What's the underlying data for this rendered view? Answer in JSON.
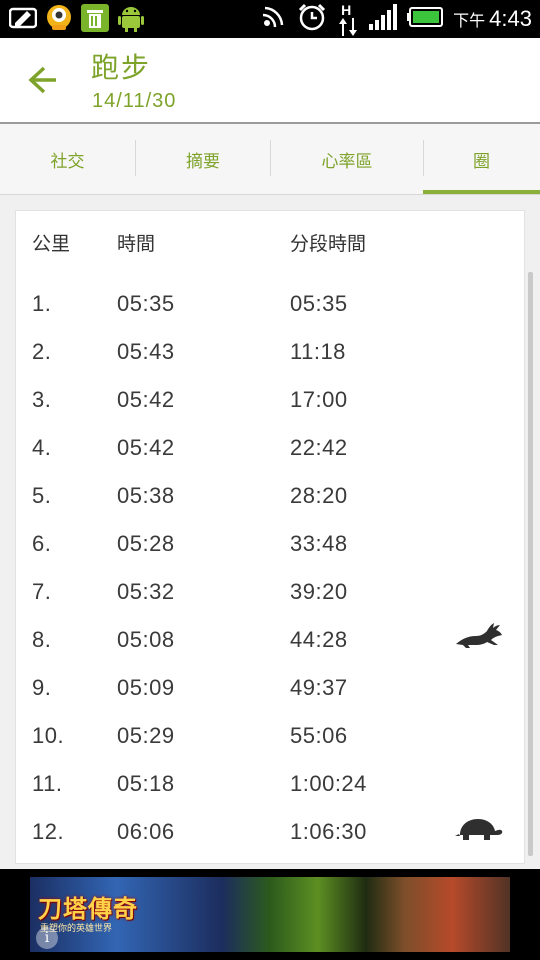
{
  "status_bar": {
    "ampm": "下午",
    "time": "4:43",
    "network": "H",
    "icons": [
      "message-edit-icon",
      "monster-app-icon",
      "trash-icon",
      "android-icon",
      "signal-waves-icon",
      "alarm-clock-icon",
      "data-arrows-icon",
      "signal-bars-icon",
      "battery-icon"
    ]
  },
  "appbar": {
    "title": "跑步",
    "subtitle": "14/11/30",
    "back_icon": "arrow-left-icon",
    "accent_color": "#7ea32a"
  },
  "tabs": [
    {
      "label": "社交"
    },
    {
      "label": "摘要"
    },
    {
      "label": "心率區"
    },
    {
      "label": "圈",
      "selected": true
    }
  ],
  "laps": {
    "headers": {
      "km": "公里",
      "time": "時間",
      "split": "分段時間"
    },
    "rows": [
      {
        "km": "1.",
        "time": "05:35",
        "split": "05:35"
      },
      {
        "km": "2.",
        "time": "05:43",
        "split": "11:18"
      },
      {
        "km": "3.",
        "time": "05:42",
        "split": "17:00"
      },
      {
        "km": "4.",
        "time": "05:42",
        "split": "22:42"
      },
      {
        "km": "5.",
        "time": "05:38",
        "split": "28:20"
      },
      {
        "km": "6.",
        "time": "05:28",
        "split": "33:48"
      },
      {
        "km": "7.",
        "time": "05:32",
        "split": "39:20"
      },
      {
        "km": "8.",
        "time": "05:08",
        "split": "44:28",
        "badge": "rabbit-icon"
      },
      {
        "km": "9.",
        "time": "05:09",
        "split": "49:37"
      },
      {
        "km": "10.",
        "time": "05:29",
        "split": "55:06"
      },
      {
        "km": "11.",
        "time": "05:18",
        "split": "1:00:24"
      },
      {
        "km": "12.",
        "time": "06:06",
        "split": "1:06:30",
        "badge": "turtle-icon"
      }
    ]
  },
  "ad": {
    "logo": "刀塔傳奇",
    "tagline": "重塑你的英雄世界",
    "info_glyph": "i"
  }
}
